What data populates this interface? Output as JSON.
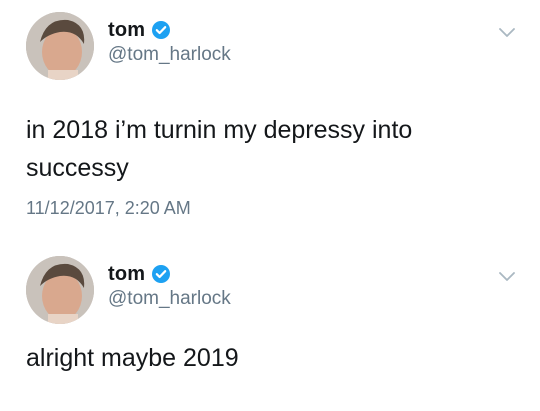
{
  "tweets": [
    {
      "display_name": "tom",
      "handle": "@tom_harlock",
      "verified": true,
      "text": "in 2018 i’m turnin my depressy into successy",
      "timestamp": "11/12/2017, 2:20 AM"
    },
    {
      "display_name": "tom",
      "handle": "@tom_harlock",
      "verified": true,
      "text": "alright maybe 2019"
    }
  ],
  "icons": {
    "verified": "verified-badge-icon",
    "menu": "chevron-down-icon"
  },
  "colors": {
    "verified_blue": "#1da1f2",
    "secondary_text": "#657786",
    "primary_text": "#14171a"
  }
}
